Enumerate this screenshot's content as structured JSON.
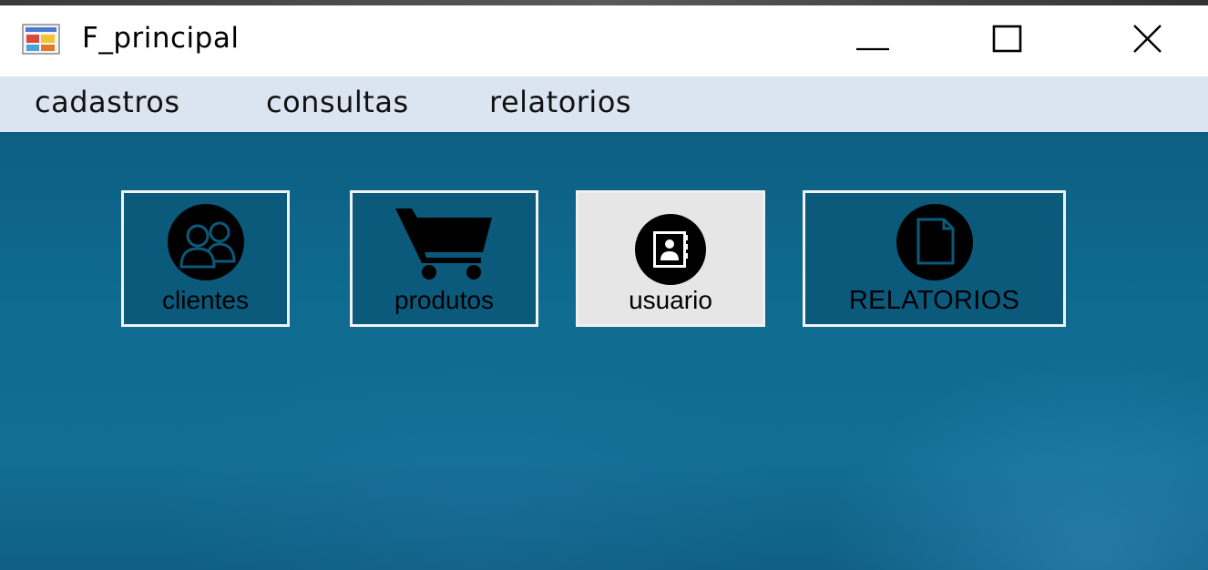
{
  "window": {
    "title": "F_principal",
    "app_icon": "winforms-app-icon",
    "controls": {
      "minimize": "minimize-icon",
      "maximize": "maximize-icon",
      "close": "close-icon"
    }
  },
  "menu": {
    "items": [
      {
        "label": "cadastros"
      },
      {
        "label": "consultas"
      },
      {
        "label": "relatorios"
      }
    ]
  },
  "tiles": [
    {
      "label": "clientes",
      "icon": "users-group-icon"
    },
    {
      "label": "produtos",
      "icon": "shopping-cart-icon"
    },
    {
      "label": "usuario",
      "icon": "contact-book-icon"
    },
    {
      "label": "RELATORIOS",
      "icon": "document-icon"
    }
  ],
  "colors": {
    "menubar": "#dbe5f1",
    "background": "#0f6b90",
    "tile_dark": "#0b5a7c",
    "tile_light": "#e6e6e6",
    "tile_border": "#f2f2f2"
  }
}
